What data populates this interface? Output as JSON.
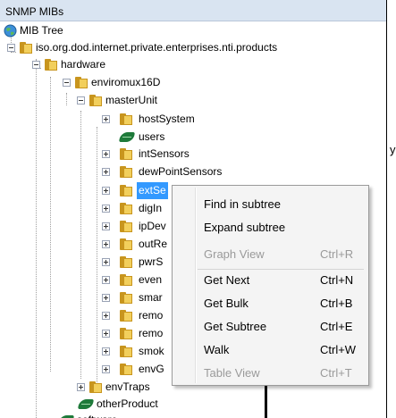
{
  "panel": {
    "title": "SNMP MIBs"
  },
  "side_label": "y",
  "tree": [
    {
      "label": "MIB Tree",
      "icon": "globe-icon"
    },
    {
      "label": "iso.org.dod.internet.private.enterprises.nti.products",
      "icon": "folder-icon",
      "expander": "minus"
    },
    {
      "label": "hardware",
      "icon": "folder-icon",
      "expander": "minus"
    },
    {
      "label": "enviromux16D",
      "icon": "folder-icon",
      "expander": "minus"
    },
    {
      "label": "masterUnit",
      "icon": "folder-icon",
      "expander": "minus"
    },
    {
      "label": "hostSystem",
      "icon": "folder-icon",
      "expander": "plus"
    },
    {
      "label": "users",
      "icon": "leaf-icon"
    },
    {
      "label": "intSensors",
      "icon": "folder-icon",
      "expander": "plus"
    },
    {
      "label": "dewPointSensors",
      "icon": "folder-icon",
      "expander": "plus"
    },
    {
      "label": "extSe",
      "icon": "folder-icon",
      "expander": "plus",
      "selected": true
    },
    {
      "label": "digIn",
      "icon": "folder-icon",
      "expander": "plus"
    },
    {
      "label": "ipDev",
      "icon": "folder-icon",
      "expander": "plus"
    },
    {
      "label": "outRe",
      "icon": "folder-icon",
      "expander": "plus"
    },
    {
      "label": "pwrS",
      "icon": "folder-icon",
      "expander": "plus"
    },
    {
      "label": "even",
      "icon": "folder-icon",
      "expander": "plus"
    },
    {
      "label": "smar",
      "icon": "folder-icon",
      "expander": "plus"
    },
    {
      "label": "remo",
      "icon": "folder-icon",
      "expander": "plus"
    },
    {
      "label": "remo",
      "icon": "folder-icon",
      "expander": "plus"
    },
    {
      "label": "smok",
      "icon": "folder-icon",
      "expander": "plus"
    },
    {
      "label": "envG",
      "icon": "folder-icon",
      "expander": "plus"
    },
    {
      "label": "envTraps",
      "icon": "folder-icon",
      "expander": "plus"
    },
    {
      "label": "otherProduct",
      "icon": "leaf-icon"
    },
    {
      "label": "software",
      "icon": "leaf-icon"
    }
  ],
  "context_menu": {
    "items": [
      {
        "label": "Find in subtree",
        "shortcut": "",
        "enabled": true
      },
      {
        "label": "Expand subtree",
        "shortcut": "",
        "enabled": true
      },
      {
        "label": "Graph View",
        "shortcut": "Ctrl+R",
        "enabled": false
      },
      {
        "label": "Get Next",
        "shortcut": "Ctrl+N",
        "enabled": true
      },
      {
        "label": "Get Bulk",
        "shortcut": "Ctrl+B",
        "enabled": true
      },
      {
        "label": "Get Subtree",
        "shortcut": "Ctrl+E",
        "enabled": true
      },
      {
        "label": "Walk",
        "shortcut": "Ctrl+W",
        "enabled": true
      },
      {
        "label": "Table View",
        "shortcut": "Ctrl+T",
        "enabled": false
      }
    ]
  }
}
